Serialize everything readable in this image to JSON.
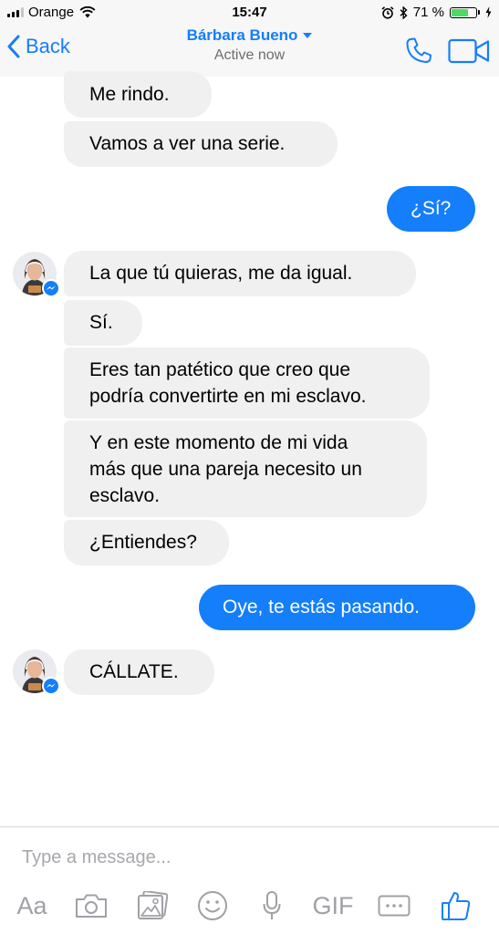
{
  "status_bar": {
    "carrier": "Orange",
    "time": "15:47",
    "battery_percent": "71 %",
    "battery_level": 0.71
  },
  "nav": {
    "back_label": "Back",
    "contact_name": "Bárbara Bueno",
    "contact_status": "Active now"
  },
  "messages": [
    {
      "from": "contact",
      "lines": [
        "Me rindo."
      ]
    },
    {
      "from": "contact",
      "lines": [
        "Vamos a ver una serie."
      ]
    },
    {
      "from": "me",
      "lines": [
        "¿Sí?"
      ]
    },
    {
      "from": "contact",
      "lines": [
        "La que tú quieras, me da igual."
      ]
    },
    {
      "from": "contact",
      "lines": [
        "Sí."
      ]
    },
    {
      "from": "contact",
      "lines": [
        "Eres tan patético que creo que",
        "podría convertirte en mi esclavo."
      ]
    },
    {
      "from": "contact",
      "lines": [
        "Y en este momento de mi vida",
        "más que una pareja necesito un",
        "esclavo."
      ]
    },
    {
      "from": "contact",
      "lines": [
        "¿Entiendes?"
      ]
    },
    {
      "from": "me",
      "lines": [
        "Oye, te estás pasando."
      ]
    },
    {
      "from": "contact",
      "lines": [
        "CÁLLATE."
      ]
    }
  ],
  "composer": {
    "placeholder": "Type a message...",
    "text_tool_label": "Aa",
    "gif_label": "GIF",
    "tools": [
      "text-format-icon",
      "camera-icon",
      "gallery-icon",
      "emoji-icon",
      "microphone-icon",
      "gif-icon",
      "more-icon",
      "like-icon"
    ]
  },
  "colors": {
    "accent": "#147efb",
    "incoming_bubble": "#f0f0f0",
    "outgoing_text": "#ffffff",
    "battery": "#4cd964",
    "icon_gray": "#a0a0a6"
  }
}
